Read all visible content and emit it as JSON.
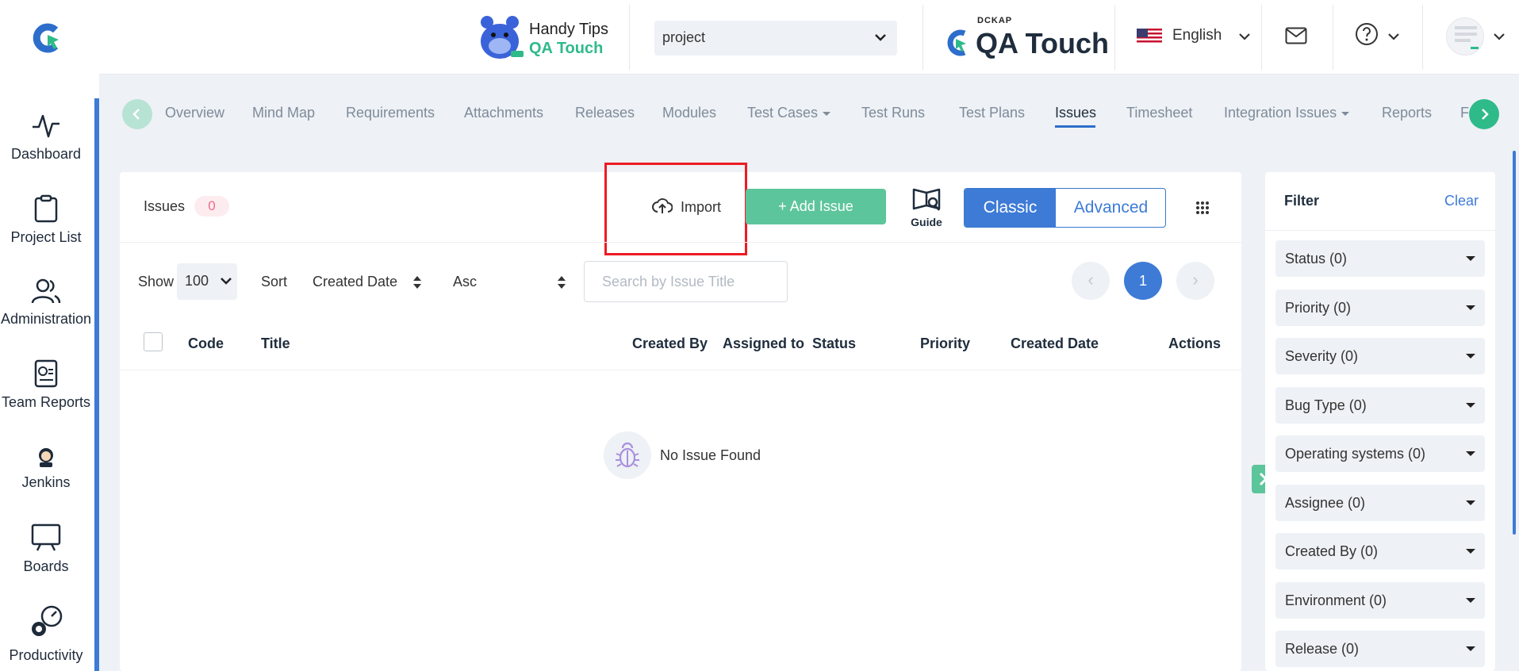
{
  "header": {
    "handy_tips_line1": "Handy Tips",
    "handy_tips_line2": "QA Touch",
    "project_value": "project",
    "brand_top": "DCKAP",
    "brand_name": "QA Touch",
    "language": "English"
  },
  "sidebar": {
    "items": [
      {
        "label": "Dashboard",
        "icon": "activity-icon"
      },
      {
        "label": "Project List",
        "icon": "clipboard-icon"
      },
      {
        "label": "Administration",
        "icon": "users-icon"
      },
      {
        "label": "Team Reports",
        "icon": "report-icon"
      },
      {
        "label": "Jenkins",
        "icon": "jenkins-icon"
      },
      {
        "label": "Boards",
        "icon": "board-icon"
      },
      {
        "label": "Productivity",
        "icon": "gear-speed-icon"
      }
    ]
  },
  "tabs": [
    {
      "label": "Overview"
    },
    {
      "label": "Mind Map"
    },
    {
      "label": "Requirements"
    },
    {
      "label": "Attachments"
    },
    {
      "label": "Releases"
    },
    {
      "label": "Modules"
    },
    {
      "label": "Test Cases"
    },
    {
      "label": "Test Runs"
    },
    {
      "label": "Test Plans"
    },
    {
      "label": "Issues",
      "active": true
    },
    {
      "label": "Timesheet"
    },
    {
      "label": "Integration Issues"
    },
    {
      "label": "Reports"
    },
    {
      "label": "F"
    }
  ],
  "toolbar": {
    "issues_label": "Issues",
    "issues_count": "0",
    "import_label": "Import",
    "add_issue_label": "+ Add Issue",
    "guide_label": "Guide",
    "classic_label": "Classic",
    "advanced_label": "Advanced"
  },
  "list_controls": {
    "show_label": "Show",
    "show_value": "100",
    "sort_label": "Sort",
    "sort_value": "Created Date",
    "order_value": "Asc",
    "search_placeholder": "Search by Issue Title",
    "page_prev": "‹",
    "current_page": "1",
    "page_next": "›"
  },
  "table": {
    "columns": [
      "Code",
      "Title",
      "Created By",
      "Assigned to",
      "Status",
      "Priority",
      "Created Date",
      "Actions"
    ],
    "empty_message": "No Issue Found"
  },
  "filter": {
    "title": "Filter",
    "clear_label": "Clear",
    "items": [
      "Status (0)",
      "Priority (0)",
      "Severity (0)",
      "Bug Type (0)",
      "Operating systems (0)",
      "Assignee (0)",
      "Created By (0)",
      "Environment (0)",
      "Release (0)"
    ]
  },
  "colors": {
    "accent_blue": "#3d7bd6",
    "accent_green": "#5dc59b",
    "highlight_red": "#ec1b23"
  }
}
